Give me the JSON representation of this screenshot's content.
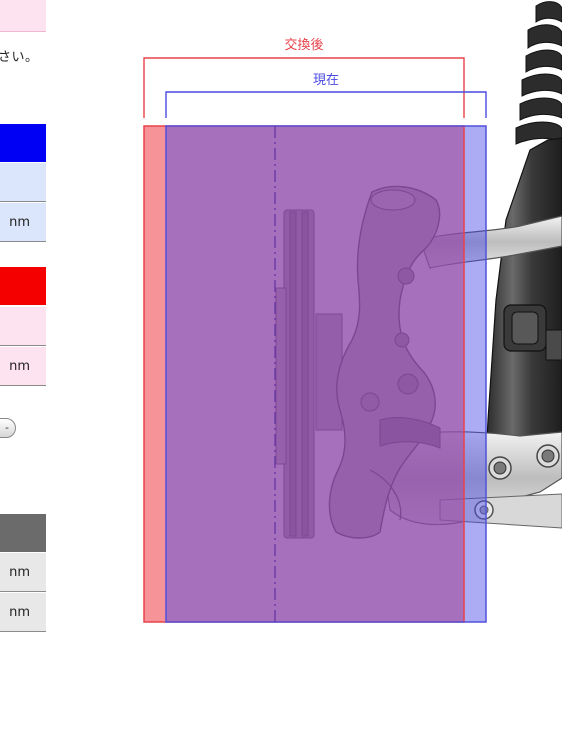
{
  "left_panel": {
    "instruction_text": "さい。",
    "current_section": {
      "color": "#0000f5",
      "row1_value": "",
      "row2_value": "nm"
    },
    "after_section": {
      "color": "#f50000",
      "row1_value": "",
      "row2_value": "nm"
    },
    "toggle_button_label": "-",
    "result_table": {
      "row1_value": "nm",
      "row2_value": "nm"
    }
  },
  "diagram": {
    "label_after": "交換後",
    "label_current": "現在",
    "colors": {
      "after": "#f0505a",
      "current": "#4848e6",
      "overlap": "#c77bb0"
    }
  }
}
